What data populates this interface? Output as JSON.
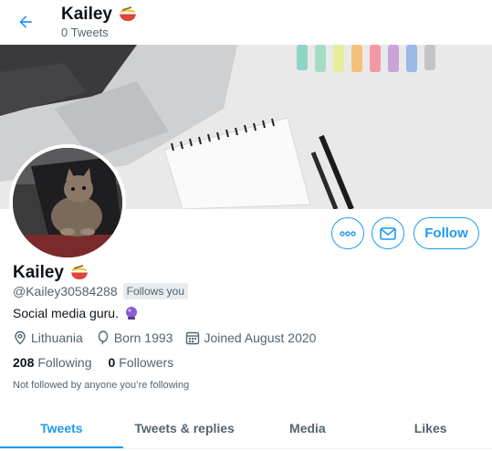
{
  "header": {
    "name": "Kailey",
    "tweet_count": "0 Tweets"
  },
  "profile": {
    "name": "Kailey",
    "handle": "@Kailey30584288",
    "follows_badge": "Follows you",
    "bio": "Social media guru.",
    "location": "Lithuania",
    "born": "Born 1993",
    "joined": "Joined August 2020",
    "following_count": "208",
    "following_label": "Following",
    "followers_count": "0",
    "followers_label": "Followers",
    "not_followed_text": "Not followed by anyone you’re following"
  },
  "actions": {
    "follow_label": "Follow"
  },
  "tabs": [
    {
      "label": "Tweets",
      "active": true
    },
    {
      "label": "Tweets & replies",
      "active": false
    },
    {
      "label": "Media",
      "active": false
    },
    {
      "label": "Likes",
      "active": false
    }
  ],
  "colors": {
    "accent": "#1d9bf0",
    "text": "#0f1419",
    "secondary": "#536471"
  },
  "icons": [
    "arrow-left-icon",
    "noodle-emoji-icon",
    "more-icon",
    "mail-icon",
    "crystal-ball-icon",
    "location-icon",
    "balloon-icon",
    "calendar-icon"
  ]
}
